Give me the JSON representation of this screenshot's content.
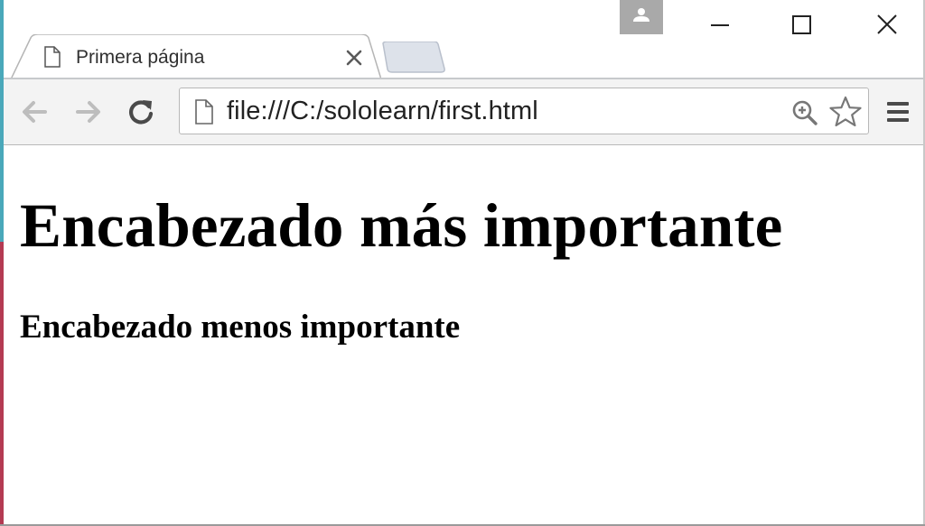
{
  "browser": {
    "tab": {
      "title": "Primera página",
      "favicon": "page-icon",
      "close_icon": "close-icon"
    },
    "window_controls": {
      "minimize_icon": "minimize-icon",
      "maximize_icon": "maximize-icon",
      "close_icon": "close-icon",
      "profile_icon": "person-icon"
    },
    "toolbar": {
      "back_icon": "arrow-left-icon",
      "forward_icon": "arrow-right-icon",
      "reload_icon": "reload-icon",
      "menu_icon": "hamburger-menu-icon"
    },
    "omnibox": {
      "url": "file:///C:/sololearn/first.html",
      "page_icon": "page-icon",
      "zoom_icon": "zoom-in-icon",
      "bookmark_icon": "star-icon"
    }
  },
  "page": {
    "heading_main": "Encabezado más importante",
    "heading_secondary": "Encabezado menos importante"
  },
  "colors": {
    "toolbar_background": "#f3f3f3",
    "profile_button": "#a9a9a9",
    "text": "#000000"
  }
}
